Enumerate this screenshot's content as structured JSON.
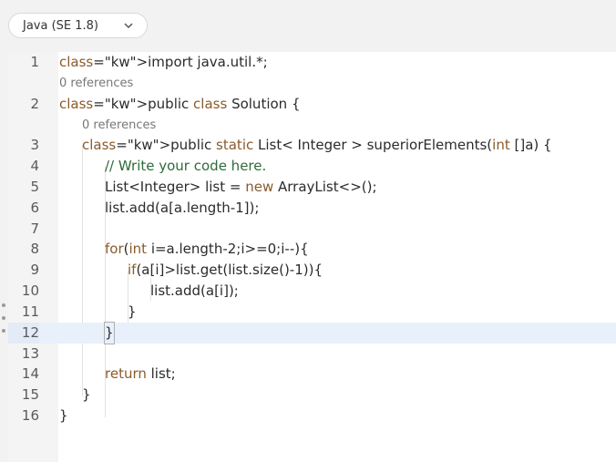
{
  "language_select": {
    "label": "Java (SE 1.8)",
    "icon": "chevron-down-icon"
  },
  "references": {
    "line1": "0 references",
    "line2": "0 references"
  },
  "code_lines": [
    {
      "n": "1",
      "text": "import java.util.*;"
    },
    {
      "n": "2",
      "text": "public class Solution {"
    },
    {
      "n": "3",
      "text": "public static List< Integer > superiorElements(int []a) {"
    },
    {
      "n": "4",
      "text": "// Write your code here."
    },
    {
      "n": "5",
      "text": "List<Integer> list = new ArrayList<>();"
    },
    {
      "n": "6",
      "text": "list.add(a[a.length-1]);"
    },
    {
      "n": "7",
      "text": ""
    },
    {
      "n": "8",
      "text": "for(int i=a.length-2;i>=0;i--){"
    },
    {
      "n": "9",
      "text": "if(a[i]>list.get(list.size()-1)){"
    },
    {
      "n": "10",
      "text": "list.add(a[i]);"
    },
    {
      "n": "11",
      "text": "}"
    },
    {
      "n": "12",
      "text": "}"
    },
    {
      "n": "13",
      "text": ""
    },
    {
      "n": "14",
      "text": "return list;"
    },
    {
      "n": "15",
      "text": "}"
    },
    {
      "n": "16",
      "text": "}"
    }
  ],
  "active_line": "12"
}
